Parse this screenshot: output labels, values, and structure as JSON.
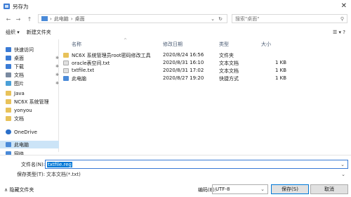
{
  "window": {
    "title": "另存为",
    "close_glyph": "✕"
  },
  "nav_buttons": [
    "←",
    "→",
    "↑"
  ],
  "address": {
    "segments": [
      "此电脑",
      "桌面"
    ],
    "separator": "›",
    "dropdown_glyph": "⌄",
    "refresh_glyph": "↻"
  },
  "search": {
    "placeholder": "搜索\"桌面\"",
    "icon": "search-icon",
    "glyph": "⚲"
  },
  "toolbar": {
    "organize": "组织 ▾",
    "new_folder": "新建文件夹",
    "view_glyphs": "☰ ▾   ?"
  },
  "sidebar": {
    "items": [
      {
        "label": "快速访问",
        "icon": "star-icon",
        "color": "#3a7bd5",
        "pinned": false,
        "selected": false
      },
      {
        "label": "桌面",
        "icon": "desktop-icon",
        "color": "#3a7bd5",
        "pinned": true,
        "selected": false
      },
      {
        "label": "下载",
        "icon": "download-icon",
        "color": "#3a7bd5",
        "pinned": true,
        "selected": false
      },
      {
        "label": "文档",
        "icon": "document-icon",
        "color": "#7a8aa0",
        "pinned": true,
        "selected": false
      },
      {
        "label": "图片",
        "icon": "picture-icon",
        "color": "#4aa0d8",
        "pinned": true,
        "selected": false
      },
      {
        "label": "Java",
        "icon": "folder-icon",
        "color": "#e8c25a",
        "pinned": false,
        "selected": false
      },
      {
        "label": "NC6X 系统管理",
        "icon": "folder-icon",
        "color": "#e8c25a",
        "pinned": false,
        "selected": false
      },
      {
        "label": "yonyou",
        "icon": "folder-icon",
        "color": "#e8c25a",
        "pinned": false,
        "selected": false
      },
      {
        "label": "文档",
        "icon": "folder-icon",
        "color": "#e8c25a",
        "pinned": false,
        "selected": false
      },
      {
        "label": "OneDrive",
        "icon": "cloud-icon",
        "color": "#2b6fc9",
        "pinned": false,
        "selected": false
      },
      {
        "label": "此电脑",
        "icon": "computer-icon",
        "color": "#4a8ad8",
        "pinned": false,
        "selected": true
      },
      {
        "label": "网络",
        "icon": "network-icon",
        "color": "#4a8ad8",
        "pinned": false,
        "selected": false
      }
    ],
    "pin_glyph": "✱"
  },
  "columns": {
    "name": "名称",
    "modified": "修改日期",
    "type": "类型",
    "size": "大小",
    "sort_glyph": "^"
  },
  "files": [
    {
      "name": "NC6X 系统管理员root密码修改工具",
      "modified": "2020/8/24 16:56",
      "type": "文件夹",
      "size": "",
      "icon": "folder-icon",
      "color": "#e8c25a"
    },
    {
      "name": "oracle表空间.txt",
      "modified": "2020/8/31 16:10",
      "type": "文本文档",
      "size": "1 KB",
      "icon": "text-file-icon",
      "color": "#e0e0e0"
    },
    {
      "name": "txtfile.txt",
      "modified": "2020/8/31 17:02",
      "type": "文本文档",
      "size": "1 KB",
      "icon": "text-file-icon",
      "color": "#e0e0e0"
    },
    {
      "name": "此电脑",
      "modified": "2020/8/27 19:20",
      "type": "快捷方式",
      "size": "1 KB",
      "icon": "shortcut-icon",
      "color": "#4a8ad8"
    }
  ],
  "save": {
    "filename_label": "文件名(N):",
    "filename_value": "txtfile.reg",
    "savetype_label": "保存类型(T):",
    "savetype_value": "文本文档(*.txt)",
    "dropdown_glyph": "⌄",
    "hide_folders": "∧ 隐藏文件夹",
    "encoding_label": "编码(E):",
    "encoding_value": "UTF-8",
    "save_button": "保存(S)",
    "cancel_button": "取消"
  }
}
